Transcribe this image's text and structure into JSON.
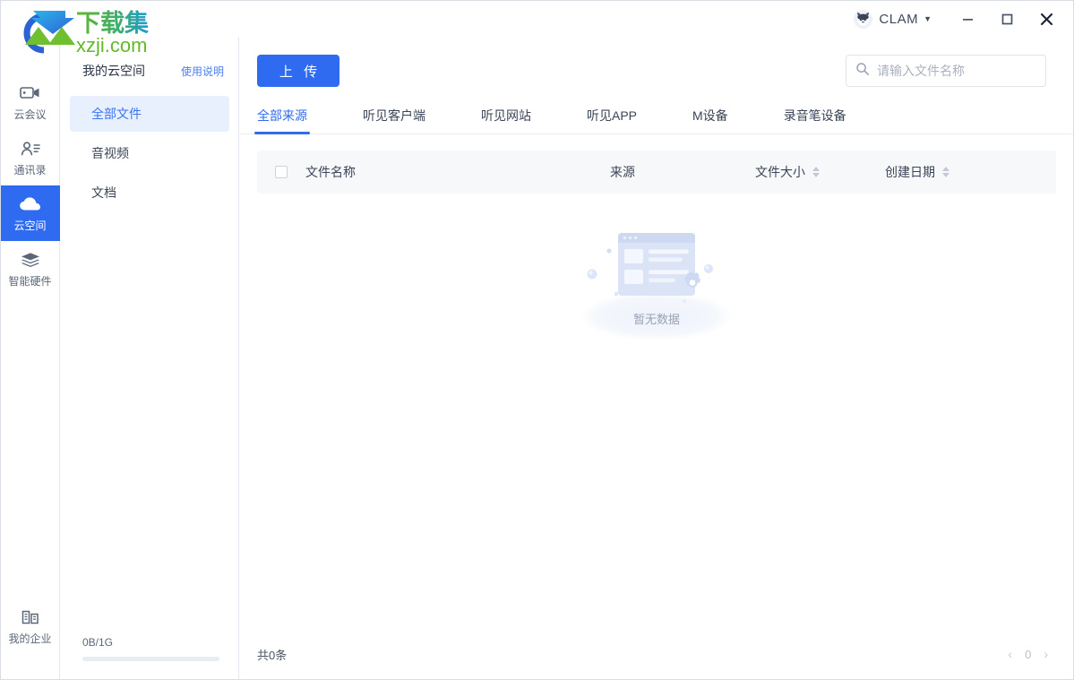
{
  "titlebar": {
    "user_name": "CLAM",
    "avatar_icon": "cat-face-icon",
    "caret_icon": "▼",
    "minimize_label": "—",
    "maximize_label": "□",
    "close_label": "✕"
  },
  "rail": {
    "items": [
      {
        "label": "云会议",
        "icon": "video-camera-icon",
        "active": false
      },
      {
        "label": "通讯录",
        "icon": "contacts-icon",
        "active": false
      },
      {
        "label": "云空间",
        "icon": "cloud-icon",
        "active": true
      },
      {
        "label": "智能硬件",
        "icon": "layers-icon",
        "active": false
      }
    ],
    "bottom_item": {
      "label": "我的企业",
      "icon": "building-icon"
    }
  },
  "subnav": {
    "title": "我的云空间",
    "help_link": "使用说明",
    "items": [
      {
        "label": "全部文件",
        "active": true
      },
      {
        "label": "音视频",
        "active": false
      },
      {
        "label": "文档",
        "active": false
      }
    ],
    "storage_text": "0B/1G",
    "storage_percent": 0
  },
  "main": {
    "upload_label": "上 传",
    "search": {
      "placeholder": "请输入文件名称",
      "value": "",
      "icon": "search-icon"
    },
    "tabs": [
      {
        "label": "全部来源",
        "active": true
      },
      {
        "label": "听见客户端",
        "active": false
      },
      {
        "label": "听见网站",
        "active": false
      },
      {
        "label": "听见APP",
        "active": false
      },
      {
        "label": "M设备",
        "active": false
      },
      {
        "label": "录音笔设备",
        "active": false
      }
    ],
    "table": {
      "columns": [
        {
          "label": "文件名称",
          "sortable": false
        },
        {
          "label": "来源",
          "sortable": false
        },
        {
          "label": "文件大小",
          "sortable": true
        },
        {
          "label": "创建日期",
          "sortable": true
        }
      ],
      "rows": [],
      "empty_text": "暂无数据"
    },
    "footer": {
      "count_text": "共0条",
      "prev_label": "‹",
      "page_number": "0",
      "next_label": "›"
    }
  },
  "watermark": {
    "title": "下载集",
    "site": "xzji.com"
  },
  "colors": {
    "accent": "#2e6bf0",
    "accent_soft": "#e8effd",
    "text": "#3b4557",
    "muted": "#9aa3b4",
    "border": "#e3e8f0",
    "table_head_bg": "#f7f8fa",
    "watermark_green": "#63b92a",
    "watermark_blue": "#1b9bd8"
  }
}
